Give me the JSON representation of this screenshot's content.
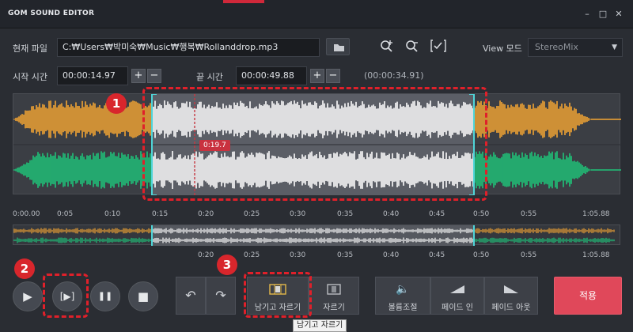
{
  "app": {
    "title": "GOM SOUND EDITOR"
  },
  "window_controls": {
    "minimize": "–",
    "maximize": "□",
    "close": "✕"
  },
  "file_row": {
    "label": "현재 파일",
    "path": "C:₩Users₩박미숙₩Music₩행복₩Rollanddrop.mp3",
    "icons": [
      "folder-icon",
      "zoom-in-icon",
      "zoom-out-icon",
      "select-check-icon"
    ],
    "view_label": "View 모드",
    "view_select": "StereoMix"
  },
  "time_row": {
    "start_label": "시작 시간",
    "start_value": "00:00:14.97",
    "end_label": "끝 시간",
    "end_value": "00:00:49.88",
    "duration": "(00:00:34.91)",
    "plus": "+",
    "minus": "−"
  },
  "waveform": {
    "playhead_label": "0:19.7",
    "colors": {
      "left_channel": "#f4a533",
      "right_channel": "#1fc47a",
      "selected": "#ffffff",
      "selection_edge": "#4fd5d8",
      "playhead": "#d8323c",
      "panel": "#3b3e44",
      "selection_bg": "#5b5e66"
    },
    "total_seconds": 65.88,
    "selection_start_seconds": 14.97,
    "selection_end_seconds": 49.88,
    "playhead_seconds": 19.7
  },
  "ruler": {
    "labels": [
      "0:00.00",
      "0:05",
      "0:10",
      "0:15",
      "0:20",
      "0:25",
      "0:30",
      "0:35",
      "0:40",
      "0:45",
      "0:50",
      "0:55",
      "1:05.88"
    ],
    "bottom_labels": [
      "0:20",
      "0:25",
      "0:30",
      "0:35",
      "0:40",
      "0:45",
      "0:50",
      "0:55",
      "1:05.88"
    ]
  },
  "controls": {
    "play": "▶",
    "play_selection": "[▶]",
    "pause": "❚❚",
    "stop": "■",
    "undo": "↶",
    "redo": "↷",
    "keep_cut": "남기고 자르기",
    "cut": "자르기",
    "volume": "볼륨조절",
    "fade_in": "페이드 인",
    "fade_out": "페이드 아웃",
    "apply": "적용"
  },
  "annotations": {
    "badge1": "1",
    "badge2": "2",
    "badge3": "3"
  },
  "tooltip": "남기고 자르기"
}
